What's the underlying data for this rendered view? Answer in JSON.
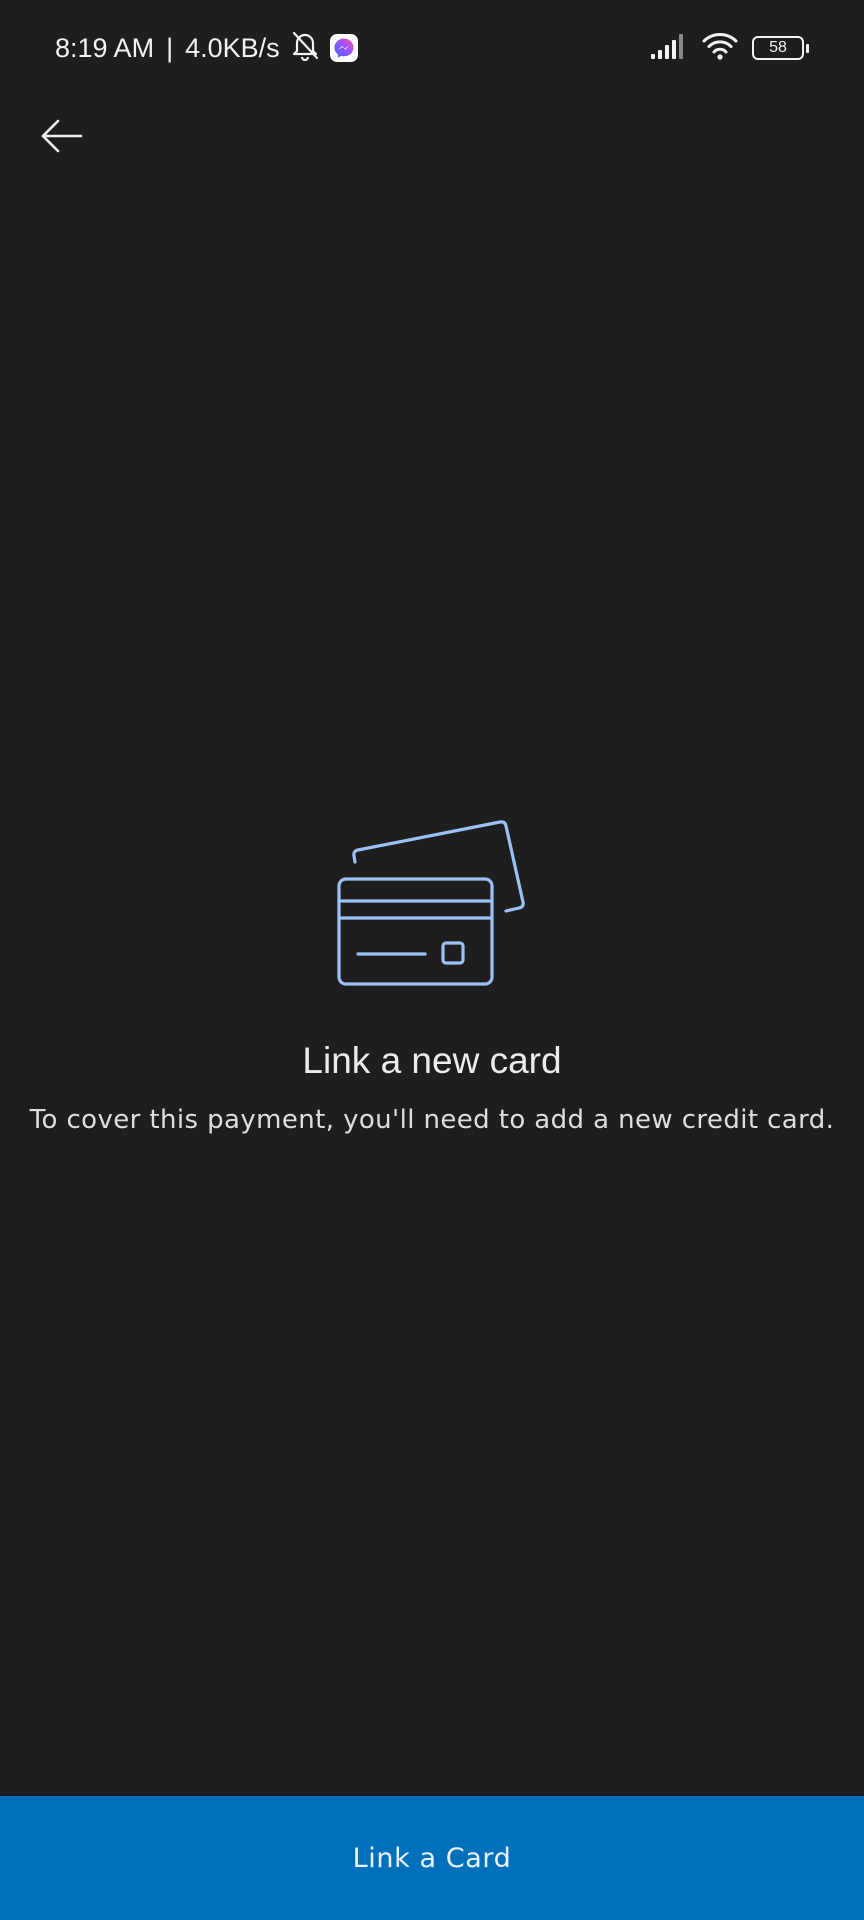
{
  "status_bar": {
    "time": "8:19 AM",
    "separator": "|",
    "network_speed": "4.0KB/s",
    "battery_level": "58",
    "icons": [
      "bell-muted-icon",
      "messenger-icon",
      "signal-icon",
      "wifi-icon",
      "battery-icon"
    ]
  },
  "header": {
    "back_icon": "back-arrow-icon"
  },
  "main": {
    "illustration_icon": "credit-cards-icon",
    "title": "Link a new card",
    "description": "To cover this payment, you'll need to add a new credit card."
  },
  "footer": {
    "button_label": "Link a Card"
  },
  "colors": {
    "background": "#1e1e1f",
    "accent": "#0070ba",
    "illustration": "#9cc2f5",
    "text": "#ececec"
  }
}
